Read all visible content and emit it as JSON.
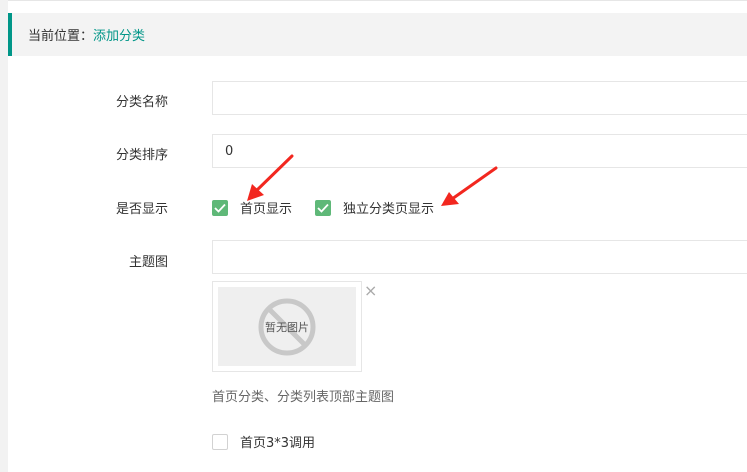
{
  "breadcrumb": {
    "prefix": "当前位置：",
    "current": "添加分类"
  },
  "form": {
    "name_label": "分类名称",
    "name_value": "",
    "sort_label": "分类排序",
    "sort_value": "0",
    "display_label": "是否显示",
    "display_options": [
      {
        "label": "首页显示",
        "checked": true
      },
      {
        "label": "独立分类页显示",
        "checked": true
      }
    ],
    "theme_label": "主题图",
    "theme_value": "",
    "no_image_text": "暂无图片",
    "delete_symbol": "×",
    "theme_hint": "首页分类、分类列表顶部主题图",
    "home_grid_option": {
      "label": "首页3*3调用",
      "checked": false
    }
  },
  "colors": {
    "accent": "#009688",
    "checkbox_checked": "#5fb878",
    "annotation_arrow": "#f2271f"
  },
  "icons": {
    "checked": "check-icon",
    "no_image": "no-image-icon",
    "delete": "close-icon",
    "annotation": "red-arrow-icon"
  }
}
